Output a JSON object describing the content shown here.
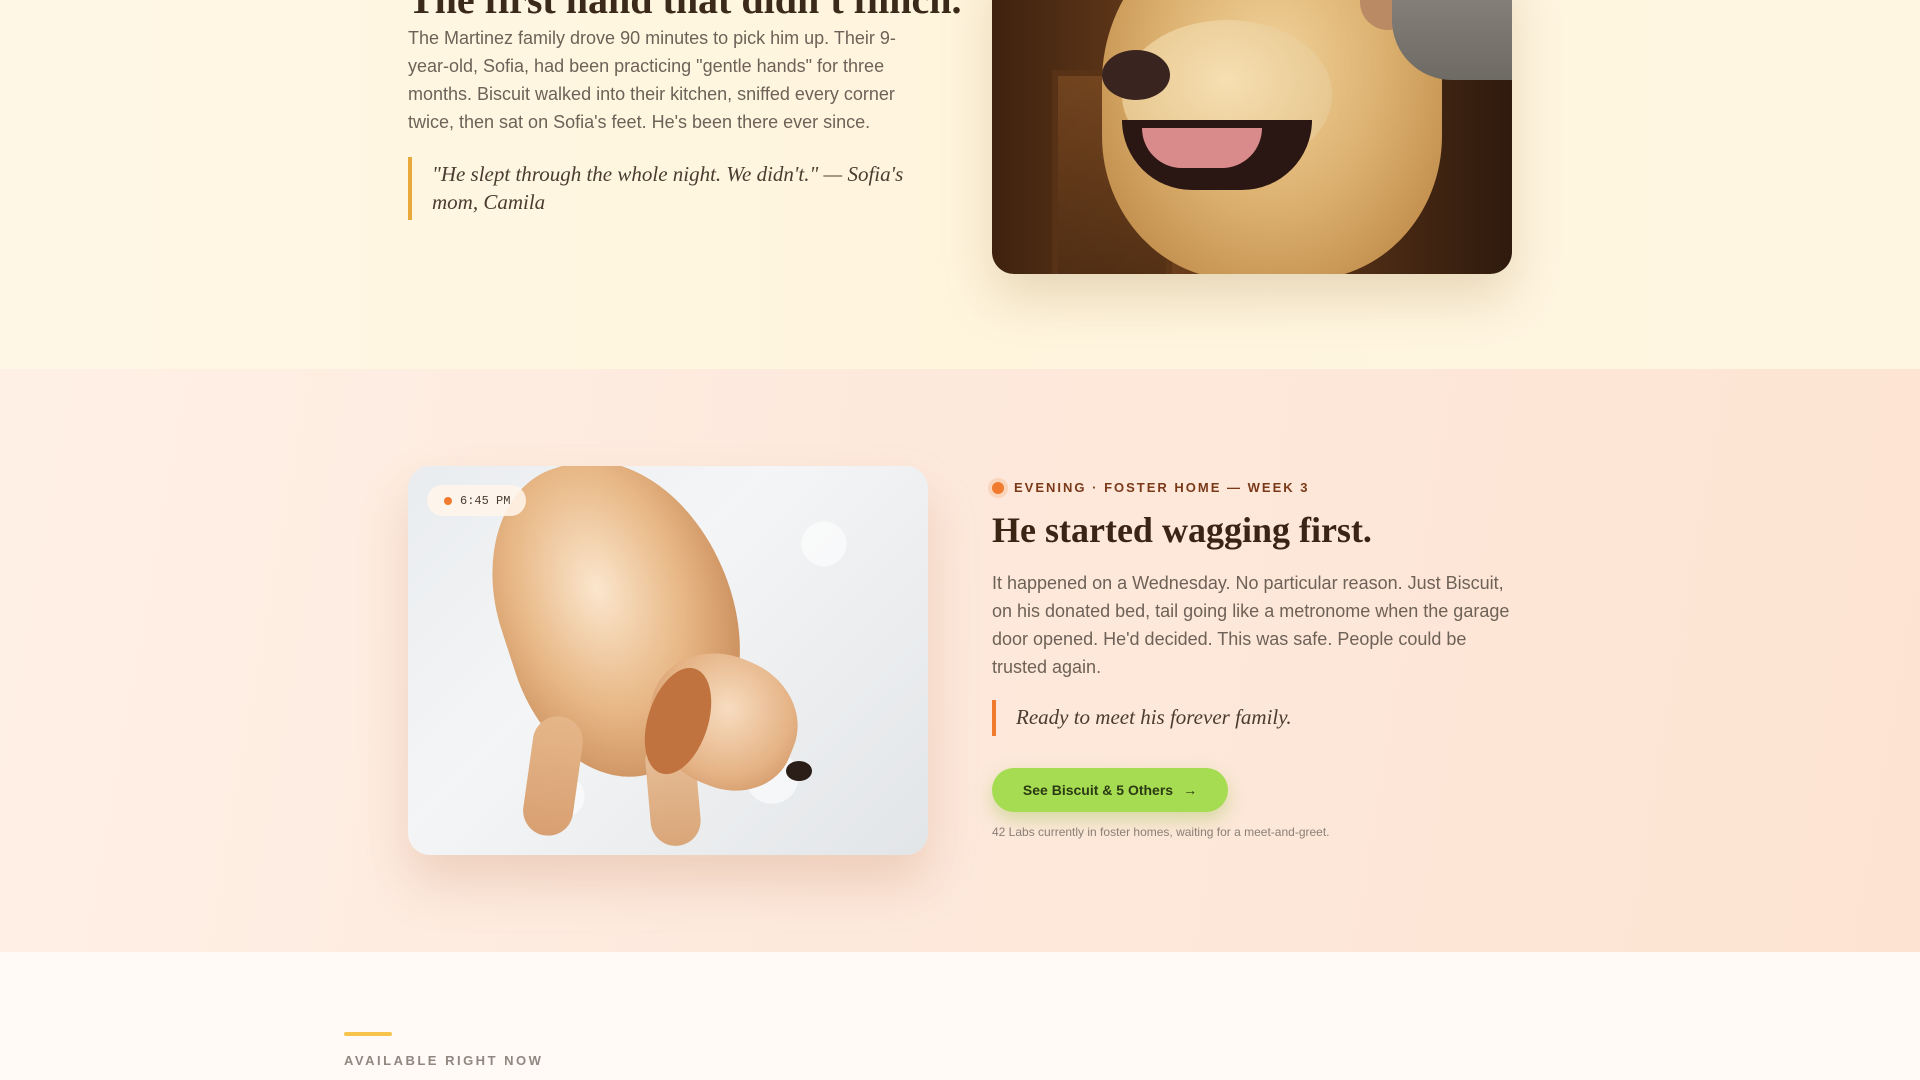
{
  "story_top": {
    "heading": "The first hand that didn't flinch.",
    "body": "The Martinez family drove 90 minutes to pick him up. Their 9-year-old, Sofia, had been practicing \"gentle hands\" for three months. Biscuit walked into their kitchen, sniffed every corner twice, then sat on Sofia's feet. He's been there ever since.",
    "quote": "\"He slept through the whole night. We didn't.\" — Sofia's mom, Camila"
  },
  "story_mid": {
    "time_chip": "6:45 PM",
    "eyebrow": "EVENING · FOSTER HOME — WEEK 3",
    "heading": "He started wagging first.",
    "body": "It happened on a Wednesday. No particular reason. Just Biscuit, on his donated bed, tail going like a metronome when the garage door opened. He'd decided. This was safe. People could be trusted again.",
    "quote": "Ready to meet his forever family.",
    "cta_label": "See Biscuit & 5 Others",
    "cta_arrow": "→",
    "note": "42 Labs currently in foster homes, waiting for a meet-and-greet."
  },
  "available": {
    "label": "AVAILABLE RIGHT NOW"
  },
  "colors": {
    "accent_orange": "#f07a2d",
    "accent_gold": "#e8a93a",
    "cta_green": "#a6dc52"
  }
}
